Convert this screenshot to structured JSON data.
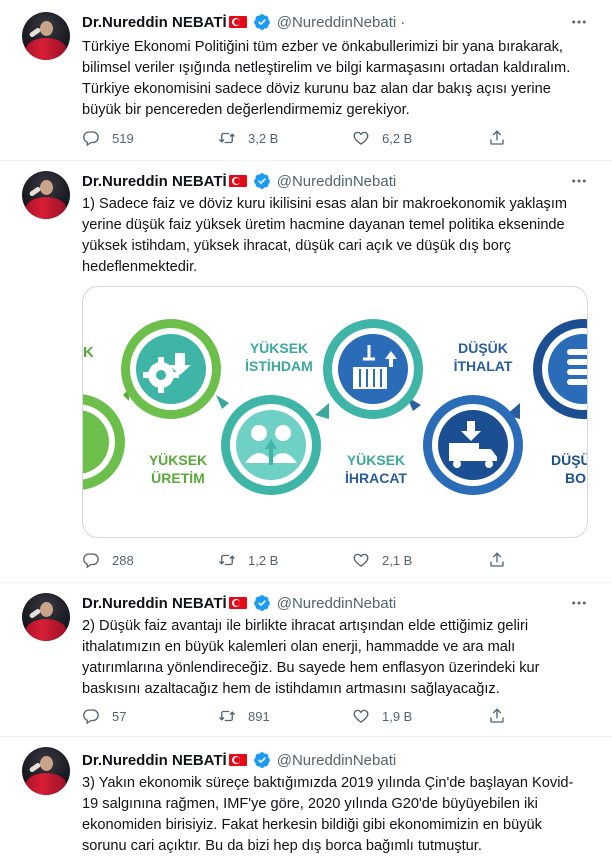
{
  "author": {
    "name": "Dr.Nureddin NEBATİ",
    "handle": "@NureddinNebati"
  },
  "tweets": [
    {
      "text": "Türkiye Ekonomi Politiğini tüm ezber ve önkabullerimizi bir yana bırakarak,\nbilimsel veriler ışığında netleştirelim ve bilgi karmaşasını ortadan kaldıralım.\nTürkiye ekonomisini sadece döviz kurunu baz alan dar bakış açısı yerine\nbüyük bir pencereden değerlendirmemiz gerekiyor.",
      "replies": "519",
      "retweets": "3,2 B",
      "likes": "6,2 B",
      "separator": "·"
    },
    {
      "text": "1) Sadece faiz ve döviz kuru ikilisini esas alan bir makroekonomik yaklaşım\nyerine düşük faiz yüksek üretim hacmine dayanan temel politika ekseninde\nyüksek istihdam, yüksek ihracat, düşük cari açık ve düşük dış borç\nhedeflenmektedir.",
      "replies": "288",
      "retweets": "1,2 B",
      "likes": "2,1 B"
    },
    {
      "text": "2) Düşük faiz avantajı ile birlikte ihracat artışından elde ettiğimiz geliri\nithalatımızın en büyük kalemleri olan enerji, hammadde ve ara malı\nyatırımlarına yönlendireceğiz. Bu sayede hem enflasyon üzerindeki kur\nbaskısını azaltacağız hem de istihdamın artmasını sağlayacağız.",
      "replies": "57",
      "retweets": "891",
      "likes": "1,9 B"
    },
    {
      "text": "3) Yakın ekonomik süreçe baktığımızda 2019 yılında Çin'de başlayan Kovid-\n19 salgınına rağmen, IMF'ye  göre, 2020 yılında G20'de büyüyebilen iki\nekonomiden birisiyiz. Fakat herkesin bildiği gibi ekonomimizin en büyük\nsorunu cari açıktır. Bu da bizi hep dış borca bağımlı tutmuştur."
    }
  ],
  "infographic": {
    "labels": {
      "left_fragment": "K",
      "yuksek_uretim_1": "YÜKSEK",
      "yuksek_uretim_2": "ÜRETİM",
      "yuksek_istihdam_1": "YÜKSEK",
      "yuksek_istihdam_2": "İSTİHDAM",
      "yuksek_ihracat_1": "YÜKSEK",
      "yuksek_ihracat_2": "İHRACAT",
      "dusuk_ithalat_1": "DÜŞÜK",
      "dusuk_ithalat_2": "İTHALAT",
      "dusuk_fragment_1": "DÜŞÜ",
      "dusuk_fragment_2": "BO"
    },
    "colors": {
      "green": "#6cbf4a",
      "teal": "#3fb5a8",
      "teal_light": "#6fd0c6",
      "blue": "#2b6cb8",
      "navy": "#1c4f91",
      "label_green": "#5aa83b",
      "label_teal": "#3aa99c",
      "label_blue": "#2a5d9f"
    }
  },
  "icons": {
    "verified": "verified-badge-icon",
    "more": "more-options-icon",
    "reply": "reply-icon",
    "retweet": "retweet-icon",
    "like": "heart-icon",
    "share": "share-icon"
  }
}
